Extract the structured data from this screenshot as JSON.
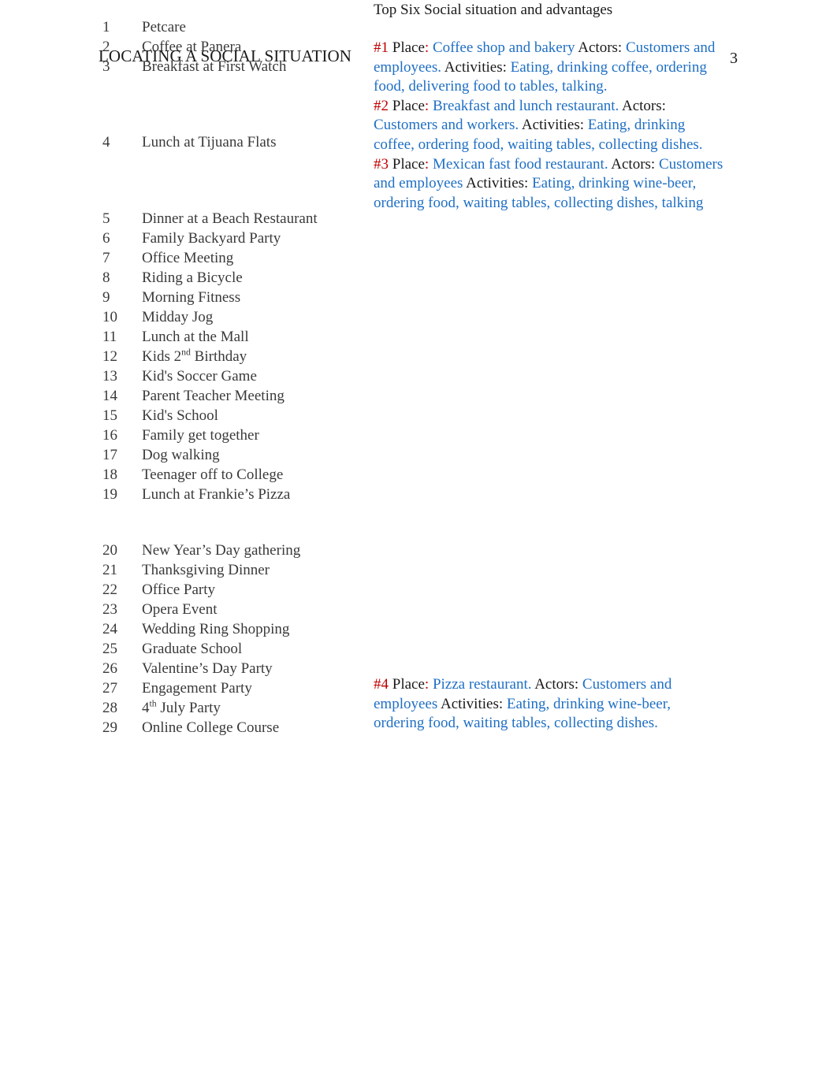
{
  "document": {
    "running_header": "LOCATING A SOCIAL SITUATION",
    "page_number": "3"
  },
  "right_column": {
    "title": "Top Six Social situation and advantages",
    "labels": {
      "place": "Place",
      "actors": "Actors:",
      "activities": "Activities:",
      "colon": ":"
    },
    "situations": [
      {
        "num": "#1",
        "place": "Coffee shop and bakery",
        "actors": "Customers and employees.",
        "activities": "Eating, drinking coffee, ordering food, delivering food to tables, talking."
      },
      {
        "num": "#2",
        "place": "Breakfast and lunch restaurant.",
        "actors": "Customers and workers.",
        "activities": "Eating, drinking coffee, ordering food, waiting tables, collecting dishes."
      },
      {
        "num": "#3",
        "place": "Mexican fast food restaurant.",
        "actors": "Customers and employees",
        "activities": "Eating, drinking wine-beer, ordering food, waiting tables, collecting dishes, talking"
      },
      {
        "num": "#4",
        "place": "Pizza restaurant.",
        "actors": "Customers and employees",
        "activities": "Eating, drinking wine-beer, ordering food, waiting tables, collecting dishes."
      }
    ]
  },
  "left_list": {
    "items": [
      {
        "n": "1",
        "t": "Petcare"
      },
      {
        "n": "2",
        "t": "Coffee at Panera"
      },
      {
        "n": "3",
        "t": "Breakfast at First Watch"
      },
      {
        "n": "4",
        "t": "Lunch at Tijuana Flats"
      },
      {
        "n": "5",
        "t": "Dinner at a Beach Restaurant"
      },
      {
        "n": "6",
        "t": "Family Backyard Party"
      },
      {
        "n": "7",
        "t": "Office Meeting"
      },
      {
        "n": "8",
        "t": "Riding a Bicycle"
      },
      {
        "n": "9",
        "t": "Morning Fitness"
      },
      {
        "n": "10",
        "t": "Midday Jog"
      },
      {
        "n": "11",
        "t": "Lunch at the Mall"
      },
      {
        "n": "12",
        "t": "Kids 2nd Birthday",
        "sup": "nd",
        "pre": "Kids 2",
        "post": " Birthday"
      },
      {
        "n": "13",
        "t": "Kid's Soccer Game"
      },
      {
        "n": "14",
        "t": "Parent Teacher Meeting"
      },
      {
        "n": "15",
        "t": "Kid's School"
      },
      {
        "n": "16",
        "t": "Family get together"
      },
      {
        "n": "17",
        "t": "Dog walking"
      },
      {
        "n": "18",
        "t": "Teenager off to College"
      },
      {
        "n": "19",
        "t": "Lunch at Frankie’s Pizza"
      },
      {
        "n": "20",
        "t": "New Year’s Day gathering"
      },
      {
        "n": "21",
        "t": "Thanksgiving Dinner"
      },
      {
        "n": "22",
        "t": "Office Party"
      },
      {
        "n": "23",
        "t": "Opera Event"
      },
      {
        "n": "24",
        "t": "Wedding Ring Shopping"
      },
      {
        "n": "25",
        "t": "Graduate School"
      },
      {
        "n": "26",
        "t": "Valentine’s Day Party"
      },
      {
        "n": "27",
        "t": "Engagement Party"
      },
      {
        "n": "28",
        "t": "4th July Party",
        "sup": "th",
        "pre": "4",
        "post": " July Party"
      },
      {
        "n": "29",
        "t": "Online College Course"
      }
    ]
  },
  "colors": {
    "accent_blue": "#1f6fc4",
    "accent_red": "#c00000",
    "body_text": "#3a3a3a",
    "heading_text": "#1a1a1a"
  }
}
